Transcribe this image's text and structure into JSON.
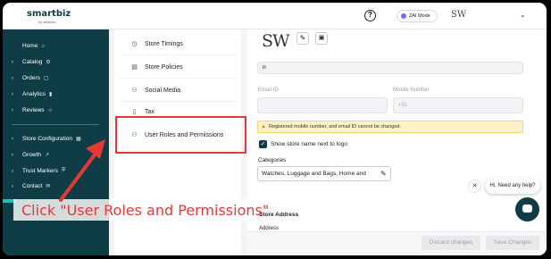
{
  "brand": {
    "name": "smartbiz",
    "sub": "by amazon"
  },
  "sidebar": {
    "items": [
      {
        "label": "Home",
        "chevron": "",
        "icon": "⌂"
      },
      {
        "label": "Catalog",
        "chevron": "›",
        "icon": "⚙"
      },
      {
        "label": "Orders",
        "chevron": "›",
        "icon": "▢"
      },
      {
        "label": "Analytics",
        "chevron": "›",
        "icon": "▮"
      },
      {
        "label": "Reviews",
        "chevron": "›",
        "icon": "☆"
      },
      {
        "label": "Store Configuration",
        "chevron": "›",
        "icon": "▦"
      },
      {
        "label": "Growth",
        "chevron": "›",
        "icon": "↗"
      },
      {
        "label": "Trust Markers",
        "chevron": "›",
        "icon": "⛨"
      },
      {
        "label": "Contact",
        "chevron": "›",
        "icon": "✉"
      }
    ]
  },
  "header": {
    "help_symbol": "?",
    "zai_mode": "ZAI Mode",
    "avatar_text": "SW",
    "dropdown_symbol": "⌄"
  },
  "settings_menu": {
    "items": [
      {
        "label": "Store Timings",
        "icon": "◷"
      },
      {
        "label": "Store Policies",
        "icon": "▤"
      },
      {
        "label": "Social Media",
        "icon": "⚇"
      },
      {
        "label": "Tax",
        "icon": "▯"
      },
      {
        "label": "User Roles and Permissions",
        "icon": "⚇"
      }
    ]
  },
  "content": {
    "logo_text": "SW",
    "store_name_value": "R",
    "email_label": "Email ID",
    "mobile_label": "Mobile Number",
    "mobile_prefix": "+91",
    "warning_text": "Registered mobile number, and email ID cannot be changed.",
    "show_store_name_label": "Show store name next to logo",
    "categories_label": "Categories",
    "categories_value": "Watches, Luggage and Bags, Home and",
    "store_address_label": "Store Address",
    "address_label": "Address"
  },
  "footer": {
    "discard_label": "Discard changes",
    "save_label": "Save Changes"
  },
  "chat": {
    "greeting": "Hi. Need any help?",
    "close_symbol": "✕"
  },
  "annotation": {
    "text": "Click \"User Roles and Permissions\""
  },
  "colors": {
    "sidebar_bg": "#0f3d45",
    "highlight": "#e53935",
    "accent": "#2bbbb5",
    "warning_bg": "#fdf2c7"
  }
}
